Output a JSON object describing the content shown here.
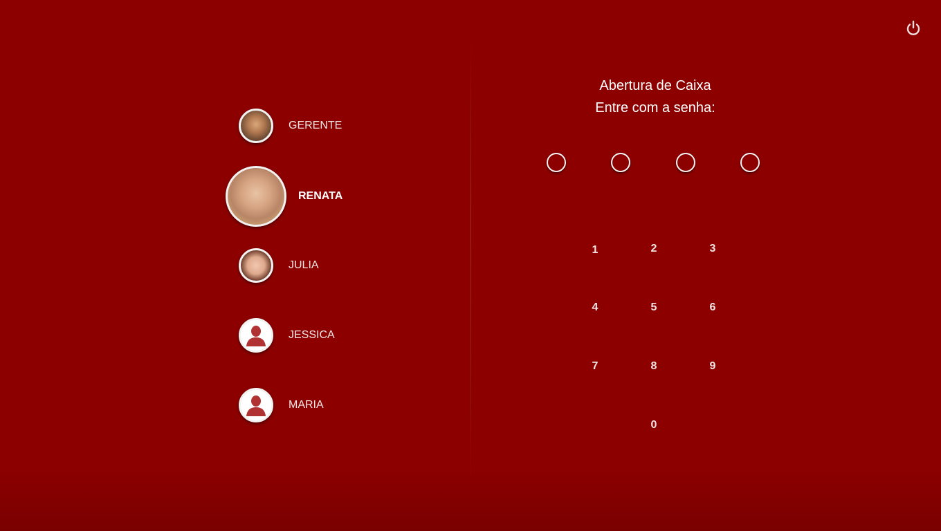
{
  "header": {
    "power_icon": "power-icon"
  },
  "users": [
    {
      "name": "GERENTE",
      "avatar": "photo"
    },
    {
      "name": "RENATA",
      "avatar": "photo",
      "selected": true
    },
    {
      "name": "JULIA",
      "avatar": "photo"
    },
    {
      "name": "JESSICA",
      "avatar": "user-silhouette-icon"
    },
    {
      "name": "MARIA",
      "avatar": "user-silhouette-icon"
    }
  ],
  "login": {
    "title": "Abertura de Caixa",
    "prompt": "Entre com a senha:",
    "pin_length": 4,
    "keypad": [
      "1",
      "2",
      "3",
      "4",
      "5",
      "6",
      "7",
      "8",
      "9",
      "0"
    ]
  },
  "colors": {
    "background": "#8c0000",
    "accent_white": "#ffffff",
    "silhouette": "#b03232"
  }
}
